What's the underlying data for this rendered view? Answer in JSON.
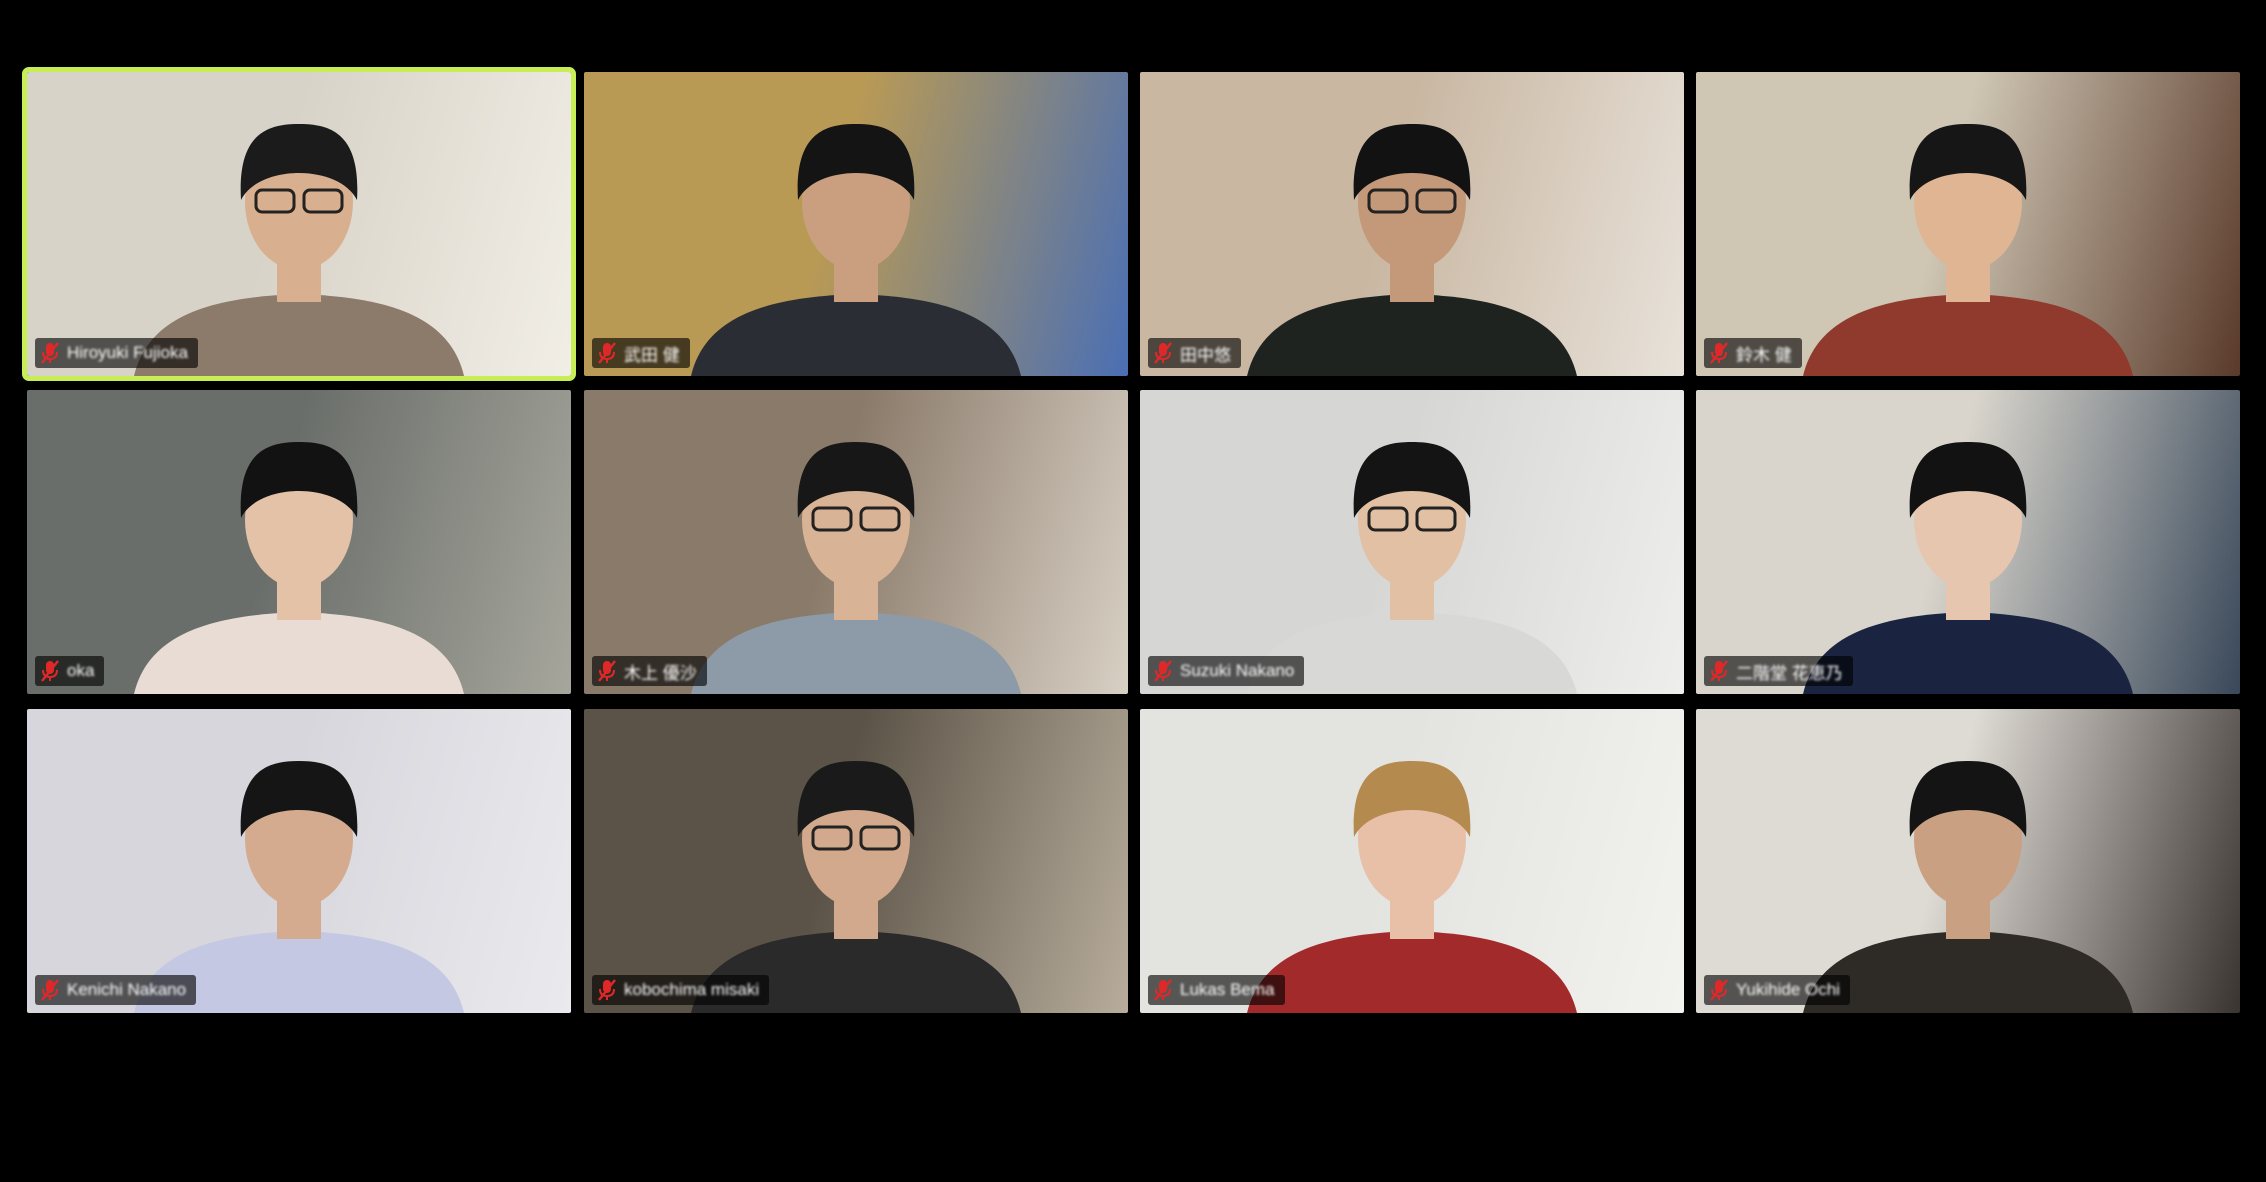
{
  "participants": [
    {
      "name": "Hiroyuki Fujioka",
      "active": true,
      "bg": "#d8d3c8",
      "bg2": "#f1eee6",
      "shirt": "#8c7a6a",
      "skin": "#d9b08f",
      "hair": "#1b1b1b",
      "glasses": true
    },
    {
      "name": "武田 健",
      "active": false,
      "bg": "#b99a55",
      "bg2": "#4a6fb4",
      "shirt": "#2a2d33",
      "skin": "#c99f7f",
      "hair": "#141414",
      "glasses": false
    },
    {
      "name": "田中悠",
      "active": false,
      "bg": "#c9b7a2",
      "bg2": "#e8e2da",
      "shirt": "#1e2320",
      "skin": "#c4997a",
      "hair": "#121212",
      "glasses": true
    },
    {
      "name": "鈴木 健",
      "active": false,
      "bg": "#cfc6b4",
      "bg2": "#5a3a2a",
      "shirt": "#8f3a2c",
      "skin": "#e0b593",
      "hair": "#161616",
      "glasses": false
    },
    {
      "name": "oka",
      "active": false,
      "bg": "#6a6e6a",
      "bg2": "#a6a69c",
      "shirt": "#e9dcd4",
      "skin": "#e3c2a8",
      "hair": "#121212",
      "glasses": false
    },
    {
      "name": "木上 優沙",
      "active": false,
      "bg": "#8a7a6a",
      "bg2": "#d8d0c4",
      "shirt": "#8d9aa8",
      "skin": "#d8b396",
      "hair": "#171717",
      "glasses": true
    },
    {
      "name": "Suzuki Nakano",
      "active": false,
      "bg": "#d6d6d4",
      "bg2": "#eeeeec",
      "shirt": "#d8d8d6",
      "skin": "#e2c0a4",
      "hair": "#141414",
      "glasses": true
    },
    {
      "name": "二階堂 花恵乃",
      "active": false,
      "bg": "#d9d5cc",
      "bg2": "#39485a",
      "shirt": "#1a2340",
      "skin": "#e6c6ae",
      "hair": "#121212",
      "glasses": false
    },
    {
      "name": "Kenichi Nakano",
      "active": false,
      "bg": "#d6d6dc",
      "bg2": "#eaeaee",
      "shirt": "#c4c8e2",
      "skin": "#d4ab8e",
      "hair": "#151515",
      "glasses": false
    },
    {
      "name": "kobochima misaki",
      "active": false,
      "bg": "#5b5347",
      "bg2": "#b8ad9c",
      "shirt": "#2a2a2a",
      "skin": "#d2a98c",
      "hair": "#1a1a1a",
      "glasses": true
    },
    {
      "name": "Lukas Bema",
      "active": false,
      "bg": "#e3e3e0",
      "bg2": "#f2f2ef",
      "shirt": "#a22a2a",
      "skin": "#e8c0a8",
      "hair": "#b58a4e",
      "glasses": false
    },
    {
      "name": "Yukihide Ochi",
      "active": false,
      "bg": "#dedad4",
      "bg2": "#3a3431",
      "shirt": "#2e2a26",
      "skin": "#caa082",
      "hair": "#141414",
      "glasses": false
    }
  ]
}
